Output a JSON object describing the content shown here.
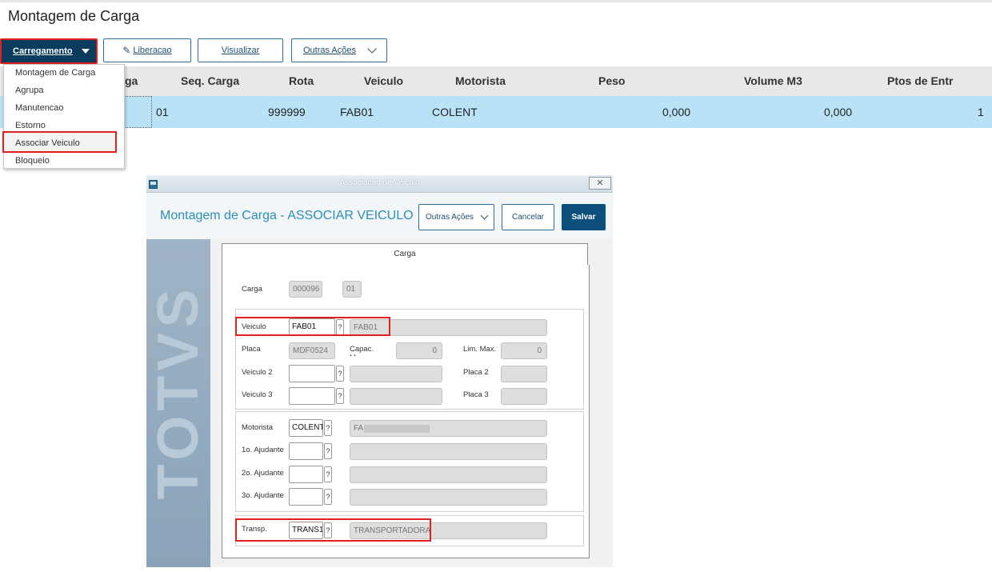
{
  "page": {
    "title": "Montagem de Carga"
  },
  "toolbar": {
    "carregamento": "Carregamento",
    "liberacao": "Liberacao",
    "visualizar": "Visualizar",
    "outras_acoes": "Outras Ações"
  },
  "menu": {
    "items": [
      "Montagem de Carga",
      "Agrupa",
      "Manutencao",
      "Estorno",
      "Associar Veiculo",
      "Bloqueio"
    ],
    "highlighted": "Associar Veiculo"
  },
  "grid": {
    "columns": [
      "ga",
      "Seq. Carga",
      "Rota",
      "Veiculo",
      "Motorista",
      "Peso",
      "Volume M3",
      "Ptos de Entr"
    ],
    "row": {
      "seq_carga": "01",
      "rota": "999999",
      "veiculo": "FAB01",
      "motorista": "COLENT",
      "peso": "0,000",
      "volume_m3": "0,000",
      "ptos_entr": "1"
    }
  },
  "dialog": {
    "window_title": "Associacao de Veiculo",
    "close_label": "✕",
    "title": "Montagem de Carga - ASSOCIAR VEICULO",
    "buttons": {
      "outras_acoes": "Outras Ações",
      "cancelar": "Cancelar",
      "salvar": "Salvar"
    },
    "brand": "TOTVS",
    "tab": "Carga",
    "carga": {
      "label": "Carga",
      "numero": "000096",
      "seq": "01"
    },
    "veiculo": {
      "label": "Veiculo",
      "codigo": "FAB01",
      "descricao": "FAB01",
      "placa_label": "Placa",
      "placa": "MDF0524",
      "capac_label": "Capac. Max",
      "capac": "0",
      "lim_label": "Lim. Max.",
      "lim": "0",
      "veiculo2_label": "Veiculo 2",
      "placa2_label": "Placa 2",
      "veiculo3_label": "Veiculo 3",
      "placa3_label": "Placa 3"
    },
    "motorista": {
      "label": "Motorista",
      "codigo": "COLENT",
      "nome": "FAB",
      "ajud1_label": "1o. Ajudante",
      "ajud2_label": "2o. Ajudante",
      "ajud3_label": "3o. Ajudante"
    },
    "transp": {
      "label": "Transp.",
      "codigo": "TRANS1",
      "nome": "TRANSPORTADORA"
    },
    "help_glyph": "?"
  }
}
